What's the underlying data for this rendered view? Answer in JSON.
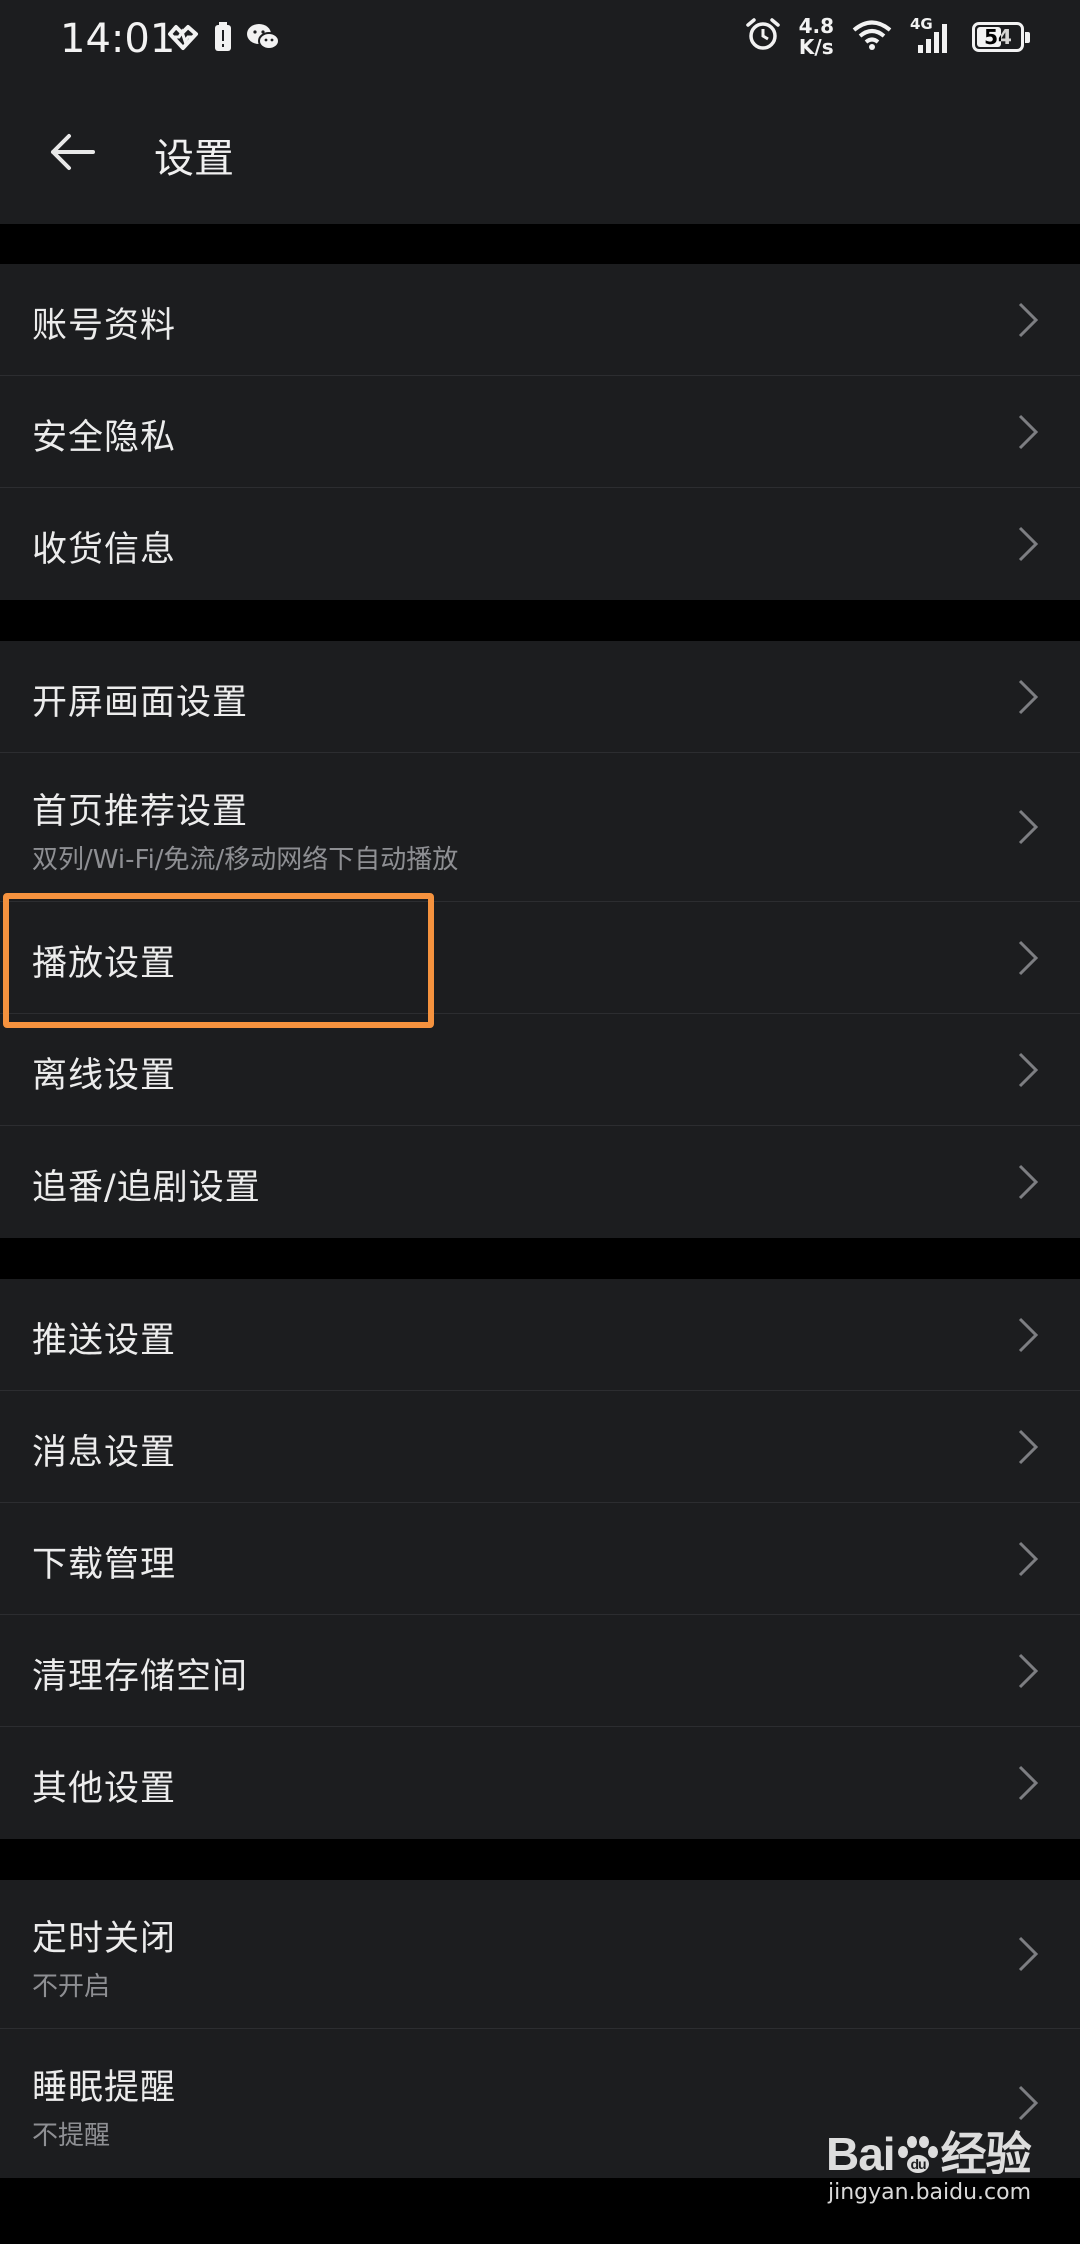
{
  "status_bar": {
    "time": "14:01",
    "net_speed_value": "4.8",
    "net_speed_unit": "K/s",
    "network_type": "4G",
    "battery": "54",
    "icons": [
      "heart-rate-icon",
      "battery-alert-icon",
      "wechat-icon",
      "alarm-icon",
      "wifi-icon",
      "signal-icon",
      "battery-icon"
    ]
  },
  "app_bar": {
    "title": "设置",
    "back_icon": "arrow-left-icon"
  },
  "sections": [
    {
      "items": [
        {
          "label": "账号资料"
        },
        {
          "label": "安全隐私"
        },
        {
          "label": "收货信息"
        }
      ]
    },
    {
      "items": [
        {
          "label": "开屏画面设置"
        },
        {
          "label": "首页推荐设置",
          "sub": "双列/Wi-Fi/免流/移动网络下自动播放"
        },
        {
          "label": "播放设置"
        },
        {
          "label": "离线设置"
        },
        {
          "label": "追番/追剧设置"
        }
      ]
    },
    {
      "items": [
        {
          "label": "推送设置"
        },
        {
          "label": "消息设置"
        },
        {
          "label": "下载管理"
        },
        {
          "label": "清理存储空间"
        },
        {
          "label": "其他设置"
        }
      ]
    },
    {
      "items": [
        {
          "label": "定时关闭",
          "sub": "不开启"
        },
        {
          "label": "睡眠提醒",
          "sub": "不提醒"
        }
      ]
    }
  ],
  "highlight_color": "#f5923e",
  "watermark": {
    "logo_text_1": "Bai",
    "logo_text_2": "经验",
    "url": "jingyan.baidu.com"
  }
}
